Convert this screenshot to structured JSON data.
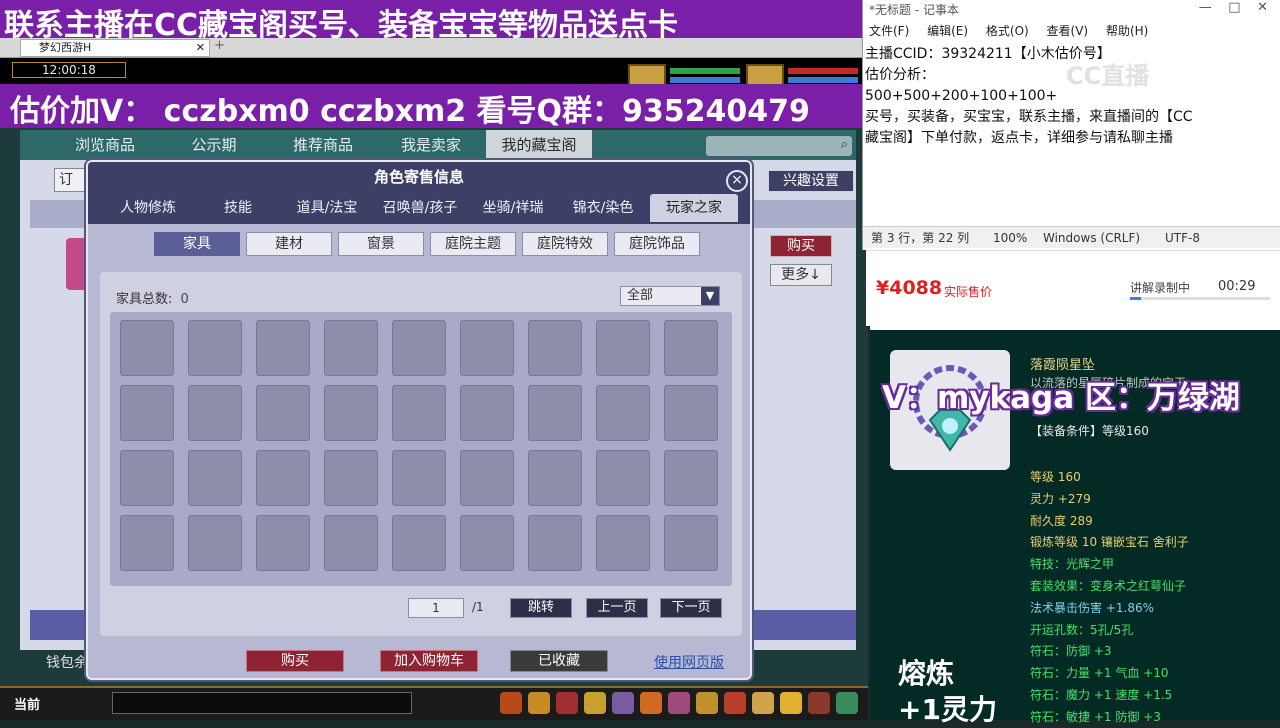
{
  "game": {
    "banner_top": "联系主播在CC藏宝阁买号、装备宝宝等物品送点卡",
    "browser_tab": "梦幻西游H",
    "clock": "12:00:18",
    "banner_contact": "估价加V：  cczbxm0    cczbxm2    看号Q群：935240479",
    "nav": [
      "浏览商品",
      "公示期",
      "推荐商品",
      "我是卖家",
      "我的藏宝阁"
    ],
    "order_btn": "订",
    "interest_btn": "兴趣设置",
    "buy_side": "购买",
    "more_side": "更多↓",
    "wallet_label": "钱包余",
    "current_label": "当前"
  },
  "dialog": {
    "title": "角色寄售信息",
    "close": "×",
    "tabs": [
      "人物修炼",
      "技能",
      "道具/法宝",
      "召唤兽/孩子",
      "坐骑/祥瑞",
      "锦衣/染色",
      "玩家之家"
    ],
    "subtabs": [
      "家具",
      "建材",
      "窗景",
      "庭院主题",
      "庭院特效",
      "庭院饰品"
    ],
    "count_label": "家具总数:",
    "count_value": "0",
    "filter_value": "全部",
    "page_current": "1",
    "page_total": "/1",
    "btn_jump": "跳转",
    "btn_prev": "上一页",
    "btn_next": "下一页",
    "btn_buy": "购买",
    "btn_cart": "加入购物车",
    "btn_fav": "已收藏",
    "web_link": "使用网页版"
  },
  "notepad": {
    "title": "*无标题 - 记事本",
    "menu": [
      "文件(F)",
      "编辑(E)",
      "格式(O)",
      "查看(V)",
      "帮助(H)"
    ],
    "text": "主播CCID：39324211【小木估价号】\n估价分析：\n500+500+200+100+100+\n买号，买装备，买宝宝，联系主播，来直播间的【CC\n藏宝阁】下单付款，返点卡，详细参与请私聊主播",
    "status_pos": "第 3 行，第 22 列",
    "status_zoom": "100%",
    "status_eol": "Windows (CRLF)",
    "status_enc": "UTF-8",
    "watermark": "CC直播"
  },
  "price": {
    "amount": "¥4088",
    "label": "实际售价",
    "recording": "讲解录制中",
    "time": "00:29",
    "progress": 0.08
  },
  "item": {
    "name": "落霞陨星坠",
    "desc": "以流落的星辰碎片制成的宝玉",
    "overlay": "V：mykaga  区：万绿湖",
    "condition": "【装备条件】等级160",
    "stats": [
      {
        "t": "等级 160",
        "c": "y"
      },
      {
        "t": "灵力 +279",
        "c": "y"
      },
      {
        "t": "耐久度 289",
        "c": "y"
      },
      {
        "t": "锻炼等级 10  镶嵌宝石 舍利子",
        "c": "y"
      },
      {
        "t": "特技：光辉之甲",
        "c": "g"
      },
      {
        "t": "套装效果：变身术之红萼仙子",
        "c": "g"
      },
      {
        "t": "法术暴击伤害 +1.86%",
        "c": "c"
      },
      {
        "t": "开运孔数：5孔/5孔",
        "c": "g"
      },
      {
        "t": "符石：防御 +3",
        "c": "g"
      },
      {
        "t": "符石：力量 +1  气血 +10",
        "c": "g"
      },
      {
        "t": "符石：魔力 +1  速度 +1.5",
        "c": "g"
      },
      {
        "t": "符石：敏捷 +1  防御 +3",
        "c": "g"
      }
    ],
    "refine1": "熔炼",
    "refine2": "+1灵力"
  }
}
